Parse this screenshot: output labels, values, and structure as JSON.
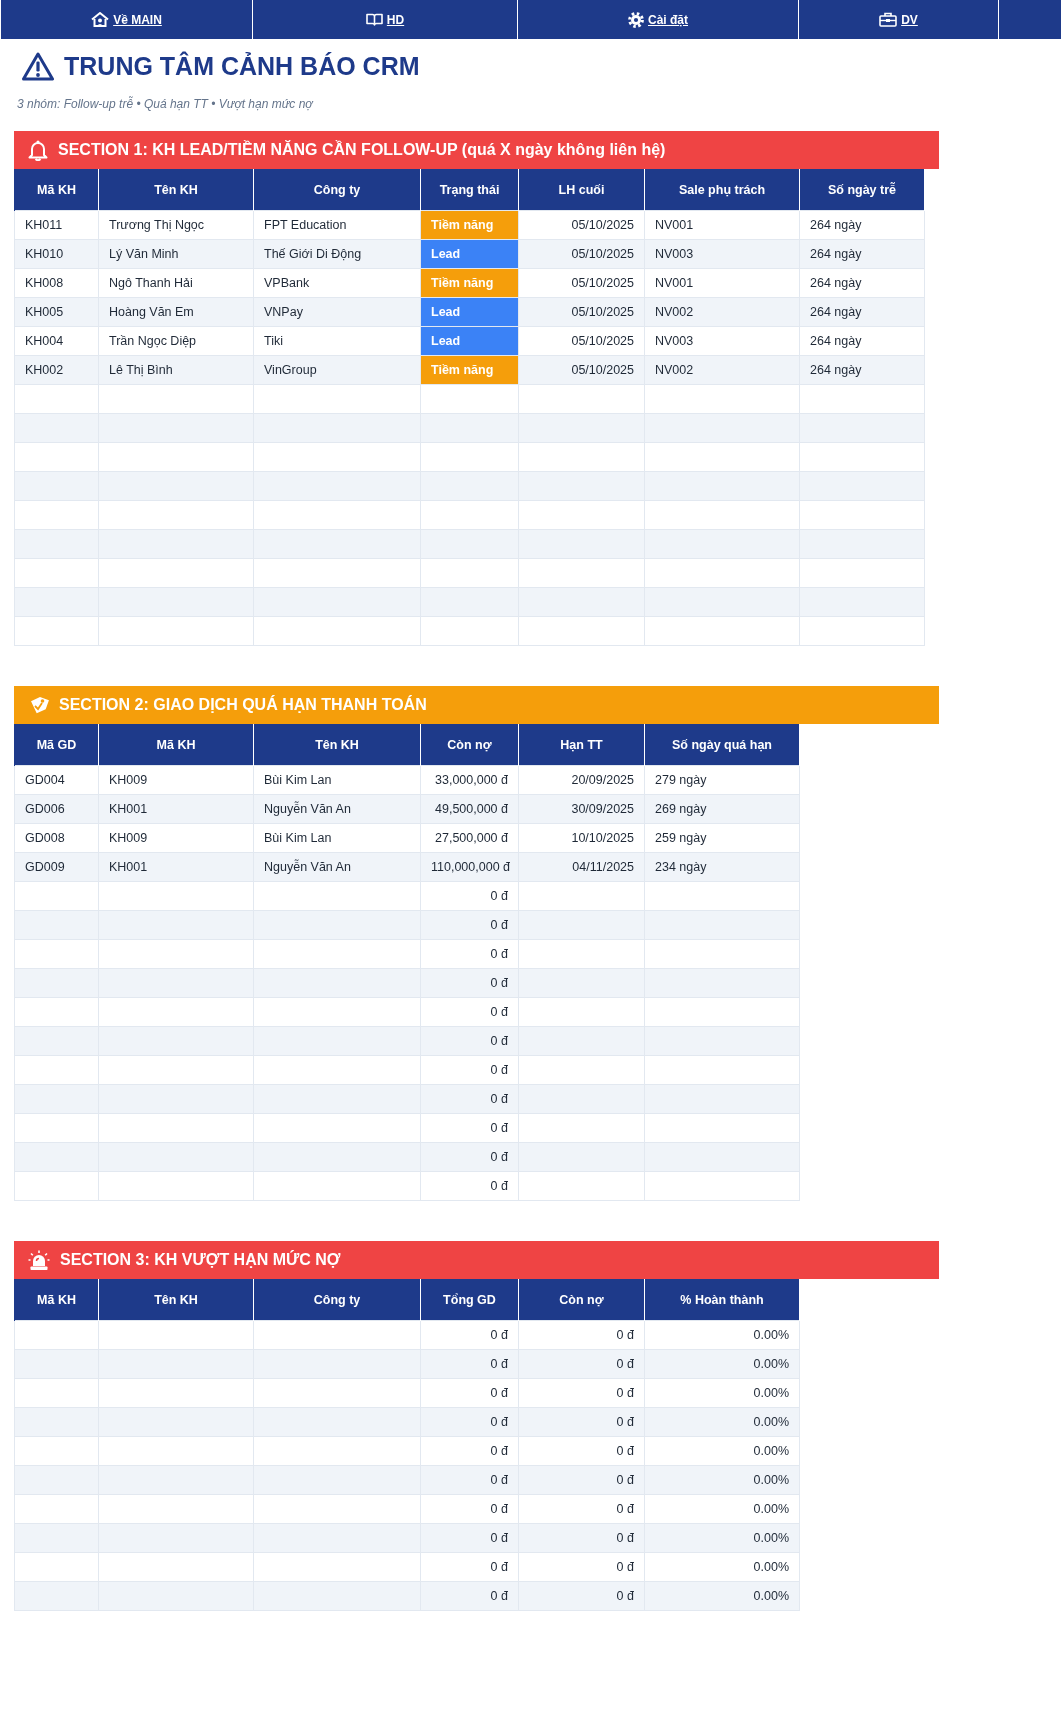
{
  "nav": [
    {
      "label": "Về MAIN"
    },
    {
      "label": "HD"
    },
    {
      "label": "Cài đặt"
    },
    {
      "label": "DV"
    }
  ],
  "title": "TRUNG TÂM CẢNH BÁO CRM",
  "subtitle": "3 nhóm: Follow-up trễ • Quá hạn TT • Vượt hạn mức nợ",
  "sections": [
    {
      "title": "SECTION 1: KH LEAD/TIỀM NĂNG CẦN FOLLOW-UP (quá X ngày không liên hệ)",
      "color": "#ef4444",
      "columns": [
        {
          "label": "Mã KH",
          "kind": "text"
        },
        {
          "label": "Tên KH",
          "kind": "text"
        },
        {
          "label": "Công ty",
          "kind": "text"
        },
        {
          "label": "Trạng thái",
          "kind": "status"
        },
        {
          "label": "LH cuối",
          "kind": "number"
        },
        {
          "label": "Sale phụ trách",
          "kind": "text"
        },
        {
          "label": "Số ngày trễ",
          "kind": "text"
        }
      ],
      "rows": [
        {
          "cells": [
            "KH011",
            "Trương Thị Ngọc",
            "FPT Education",
            "Tiềm năng",
            "05/10/2025",
            "NV001",
            "264 ngày"
          ],
          "color": "#f59e0b"
        },
        {
          "cells": [
            "KH010",
            "Lý Văn Minh",
            "Thế Giới Di Động",
            "Lead",
            "05/10/2025",
            "NV003",
            "264 ngày"
          ],
          "color": "#3b82f6"
        },
        {
          "cells": [
            "KH008",
            "Ngô Thanh Hải",
            "VPBank",
            "Tiềm năng",
            "05/10/2025",
            "NV001",
            "264 ngày"
          ],
          "color": "#f59e0b"
        },
        {
          "cells": [
            "KH005",
            "Hoàng Văn Em",
            "VNPay",
            "Lead",
            "05/10/2025",
            "NV002",
            "264 ngày"
          ],
          "color": "#3b82f6"
        },
        {
          "cells": [
            "KH004",
            "Trần Ngọc Diệp",
            "Tiki",
            "Lead",
            "05/10/2025",
            "NV003",
            "264 ngày"
          ],
          "color": "#3b82f6"
        },
        {
          "cells": [
            "KH002",
            "Lê Thị Bình",
            "VinGroup",
            "Tiềm năng",
            "05/10/2025",
            "NV002",
            "264 ngày"
          ],
          "color": "#f59e0b"
        },
        {},
        {},
        {},
        {},
        {},
        {},
        {},
        {},
        {}
      ]
    },
    {
      "title": "SECTION 2: GIAO DỊCH QUÁ HẠN THANH TOÁN",
      "color": "#f59e0b",
      "columns": [
        {
          "label": "Mã GD",
          "kind": "text"
        },
        {
          "label": "Mã KH",
          "kind": "text"
        },
        {
          "label": "Tên KH",
          "kind": "text"
        },
        {
          "label": "Còn nợ",
          "kind": "number"
        },
        {
          "label": "Hạn TT",
          "kind": "number"
        },
        {
          "label": "Số ngày quá hạn",
          "kind": "text"
        }
      ],
      "rows": [
        {
          "cells": [
            "GD004",
            "KH009",
            "Bùi Kim Lan",
            "33,000,000 đ",
            "20/09/2025",
            "279 ngày"
          ]
        },
        {
          "cells": [
            "GD006",
            "KH001",
            "Nguyễn Văn An",
            "49,500,000 đ",
            "30/09/2025",
            "269 ngày"
          ]
        },
        {
          "cells": [
            "GD008",
            "KH009",
            "Bùi Kim Lan",
            "27,500,000 đ",
            "10/10/2025",
            "259 ngày"
          ]
        },
        {
          "cells": [
            "GD009",
            "KH001",
            "Nguyễn Văn An",
            "110,000,000 đ",
            "04/11/2025",
            "234 ngày"
          ]
        },
        {
          "cells": [
            null,
            null,
            null,
            "0 đ"
          ]
        },
        {
          "cells": [
            null,
            null,
            null,
            "0 đ"
          ]
        },
        {
          "cells": [
            null,
            null,
            null,
            "0 đ"
          ]
        },
        {
          "cells": [
            null,
            null,
            null,
            "0 đ"
          ]
        },
        {
          "cells": [
            null,
            null,
            null,
            "0 đ"
          ]
        },
        {
          "cells": [
            null,
            null,
            null,
            "0 đ"
          ]
        },
        {
          "cells": [
            null,
            null,
            null,
            "0 đ"
          ]
        },
        {
          "cells": [
            null,
            null,
            null,
            "0 đ"
          ]
        },
        {
          "cells": [
            null,
            null,
            null,
            "0 đ"
          ]
        },
        {
          "cells": [
            null,
            null,
            null,
            "0 đ"
          ]
        },
        {
          "cells": [
            null,
            null,
            null,
            "0 đ"
          ]
        }
      ]
    },
    {
      "title": "SECTION 3: KH VƯỢT HẠN MỨC NỢ",
      "color": "#ef4444",
      "columns": [
        {
          "label": "Mã KH",
          "kind": "text"
        },
        {
          "label": "Tên KH",
          "kind": "text"
        },
        {
          "label": "Công ty",
          "kind": "text"
        },
        {
          "label": "Tổng GD",
          "kind": "number"
        },
        {
          "label": "Còn nợ",
          "kind": "number"
        },
        {
          "label": "% Hoàn thành",
          "kind": "number"
        }
      ],
      "rows": [
        {
          "cells": [
            null,
            null,
            null,
            "0 đ",
            "0 đ",
            "0.00%"
          ]
        },
        {
          "cells": [
            null,
            null,
            null,
            "0 đ",
            "0 đ",
            "0.00%"
          ]
        },
        {
          "cells": [
            null,
            null,
            null,
            "0 đ",
            "0 đ",
            "0.00%"
          ]
        },
        {
          "cells": [
            null,
            null,
            null,
            "0 đ",
            "0 đ",
            "0.00%"
          ]
        },
        {
          "cells": [
            null,
            null,
            null,
            "0 đ",
            "0 đ",
            "0.00%"
          ]
        },
        {
          "cells": [
            null,
            null,
            null,
            "0 đ",
            "0 đ",
            "0.00%"
          ]
        },
        {
          "cells": [
            null,
            null,
            null,
            "0 đ",
            "0 đ",
            "0.00%"
          ]
        },
        {
          "cells": [
            null,
            null,
            null,
            "0 đ",
            "0 đ",
            "0.00%"
          ]
        },
        {
          "cells": [
            null,
            null,
            null,
            "0 đ",
            "0 đ",
            "0.00%"
          ]
        },
        {
          "cells": [
            null,
            null,
            null,
            "0 đ",
            "0 đ",
            "0.00%"
          ]
        }
      ]
    }
  ]
}
